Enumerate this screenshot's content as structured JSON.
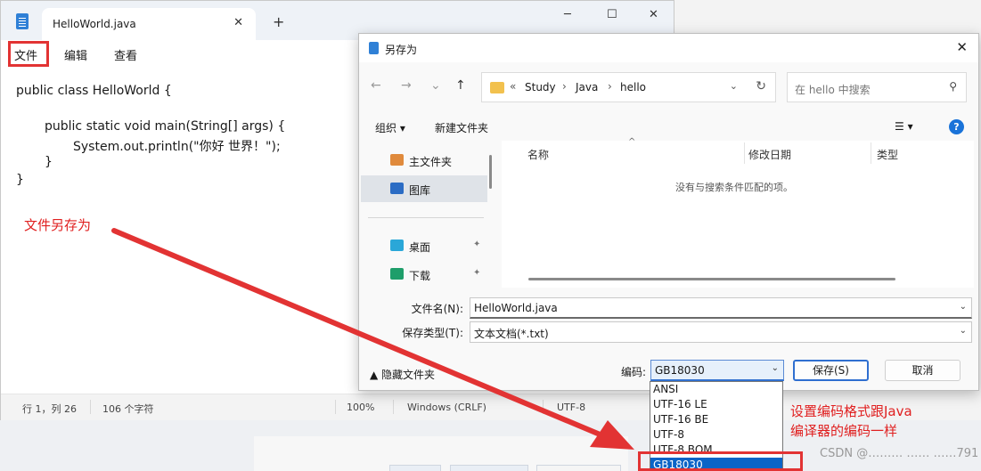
{
  "notepad": {
    "tab_title": "HelloWorld.java",
    "tab_close": "✕",
    "new_tab": "+",
    "win_min": "─",
    "win_max": "☐",
    "win_close": "✕",
    "menu": [
      "文件",
      "编辑",
      "查看"
    ],
    "code": [
      "public class HelloWorld {",
      "public static void main(String[] args) {",
      "System.out.println(\"你好 世界！\");",
      "}",
      "}"
    ],
    "status": {
      "position": "行 1，列 26",
      "chars": "106 个字符",
      "zoom": "100%",
      "line_ending": "Windows (CRLF)",
      "encoding": "UTF-8"
    }
  },
  "annotations": {
    "save_as_note": "文件另存为",
    "encoding_note_line1": "设置编码格式跟Java",
    "encoding_note_line2": "编译器的编码一样"
  },
  "dialog": {
    "title": "另存为",
    "close": "✕",
    "nav": {
      "back": "←",
      "forward": "→",
      "recent": "⌄",
      "up": "↑"
    },
    "breadcrumb": [
      "«",
      "Study",
      "Java",
      "hello"
    ],
    "crumb_sep": "›",
    "refresh": "↻",
    "search_placeholder": "在 hello 中搜索",
    "toolbar": {
      "organize": "组织 ▾",
      "new_folder": "新建文件夹",
      "view": "☰ ▾",
      "help": "?"
    },
    "sidebar": [
      {
        "label": "主文件夹",
        "icon": "home-icon",
        "color": "#e08a3c"
      },
      {
        "label": "图库",
        "icon": "gallery-icon",
        "color": "#2b6cc4"
      },
      {
        "label": "桌面",
        "icon": "desktop-icon",
        "color": "#2aa7d8",
        "pin": "📌"
      },
      {
        "label": "下载",
        "icon": "download-icon",
        "color": "#1e9e6a",
        "pin": "📌"
      }
    ],
    "columns": [
      "名称",
      "修改日期",
      "类型"
    ],
    "empty_message": "没有与搜索条件匹配的项。",
    "filename_label": "文件名(N):",
    "filename_value": "HelloWorld.java",
    "filetype_label": "保存类型(T):",
    "filetype_value": "文本文档(*.txt)",
    "hide_folders": "▲  隐藏文件夹",
    "encoding_label": "编码:",
    "encoding_value": "GB18030",
    "save_button": "保存(S)",
    "cancel_button": "取消"
  },
  "encoding_options": [
    "ANSI",
    "UTF-16 LE",
    "UTF-16 BE",
    "UTF-8",
    "UTF-8 BOM",
    "GB18030"
  ],
  "watermark": "CSDN @……… …… ……791",
  "colors": {
    "annotation_red": "#e23333",
    "accent_blue": "#0a64c7"
  }
}
